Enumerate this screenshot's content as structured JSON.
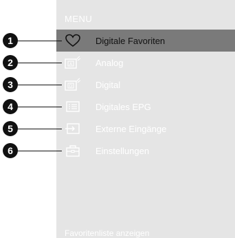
{
  "menu": {
    "title": "MENU",
    "footer_hint": "Favoritenliste anzeigen",
    "items": [
      {
        "label": "Digitale Favoriten",
        "icon": "heart-icon",
        "badge": "1",
        "selected": true
      },
      {
        "label": "Analog",
        "icon": "analog-tv-icon",
        "badge": "2"
      },
      {
        "label": "Digital",
        "icon": "digital-tv-icon",
        "badge": "3"
      },
      {
        "label": "Digitales EPG",
        "icon": "epg-list-icon",
        "badge": "4"
      },
      {
        "label": "Externe Eingänge",
        "icon": "input-source-icon",
        "badge": "5"
      },
      {
        "label": "Einstellungen",
        "icon": "toolbox-icon",
        "badge": "6"
      }
    ]
  },
  "colors": {
    "panel_bg": "#e5e5e5",
    "selected_bg": "#7a7a7a",
    "text": "#ffffff",
    "badge": "#111111"
  }
}
